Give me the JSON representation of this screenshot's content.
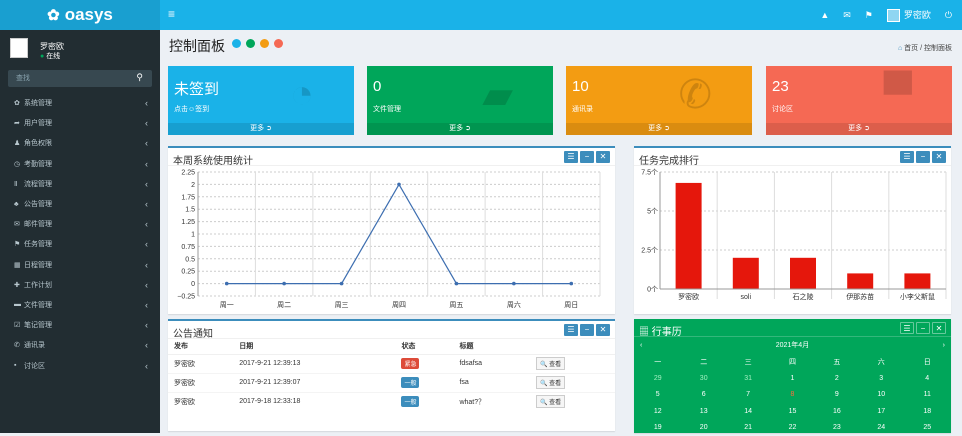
{
  "brand": {
    "logo_text": "oasys",
    "logo_icon": "gear-icon"
  },
  "topbar": {
    "menu_icon": "≡",
    "user_name": "罗密欧",
    "icons": [
      "bell-icon",
      "mail-icon",
      "flag-icon",
      "power-icon"
    ]
  },
  "sidebar": {
    "user_name": "罗密欧",
    "status": "在线",
    "search_placeholder": "查找",
    "items": [
      {
        "label": "系统管理",
        "icon": "✿"
      },
      {
        "label": "用户管理",
        "icon": "➦"
      },
      {
        "label": "角色权限",
        "icon": "♟"
      },
      {
        "label": "考勤管理",
        "icon": "◷"
      },
      {
        "label": "流程管理",
        "icon": "Ⅱ"
      },
      {
        "label": "公告管理",
        "icon": "♣"
      },
      {
        "label": "邮件管理",
        "icon": "✉"
      },
      {
        "label": "任务管理",
        "icon": "⚑"
      },
      {
        "label": "日程管理",
        "icon": "▦"
      },
      {
        "label": "工作计划",
        "icon": "✚"
      },
      {
        "label": "文件管理",
        "icon": "▬"
      },
      {
        "label": "笔记管理",
        "icon": "☑"
      },
      {
        "label": "通讯录",
        "icon": "✆"
      },
      {
        "label": "讨论区",
        "icon": "▪"
      }
    ]
  },
  "header": {
    "title": "控制面板",
    "dot_colors": [
      "#1ab2e8",
      "#00a65a",
      "#f39c12",
      "#f56954"
    ],
    "crumb_home": "首页",
    "crumb_current": "控制面板"
  },
  "stat_boxes": [
    {
      "num": "未签到",
      "label": "点击☺签到",
      "color": "#1ab2e8",
      "icon": "◔",
      "more": "更多 ➲"
    },
    {
      "num": "0",
      "label": "文件管理",
      "color": "#00a65a",
      "icon": "▰",
      "more": "更多 ➲"
    },
    {
      "num": "10",
      "label": "通讯录",
      "color": "#f39c12",
      "icon": "✆",
      "more": "更多 ➲"
    },
    {
      "num": "23",
      "label": "讨论区",
      "color": "#f56954",
      "icon": "▀",
      "more": "更多 ➲"
    }
  ],
  "line_panel": {
    "title": "本周系统使用统计",
    "tools": [
      "☰",
      "−",
      "✕"
    ]
  },
  "bar_panel": {
    "title": "任务完成排行",
    "tools": [
      "☰",
      "−",
      "✕"
    ]
  },
  "notice_panel": {
    "title": "公告通知",
    "tools": [
      "☰",
      "−",
      "✕"
    ],
    "columns": [
      "发布",
      "日期",
      "状态",
      "标题"
    ],
    "rows": [
      {
        "author": "罗密欧",
        "date": "2017-9-21 12:39:13",
        "status": "紧急",
        "status_color": "#dd4b39",
        "title": "fdsafsa",
        "action": "🔍 查看"
      },
      {
        "author": "罗密欧",
        "date": "2017-9-21 12:39:07",
        "status": "一般",
        "status_color": "#3c8dbc",
        "title": "fsa",
        "action": "🔍 查看"
      },
      {
        "author": "罗密欧",
        "date": "2017-9-18 12:33:18",
        "status": "一般",
        "status_color": "#3c8dbc",
        "title": "what?？",
        "action": "🔍 查看"
      }
    ]
  },
  "calendar_panel": {
    "title": "行事历",
    "tools": [
      "☰",
      "−",
      "✕"
    ],
    "month": "2021年4月",
    "prev": "‹",
    "next": "›",
    "weekdays": [
      "一",
      "二",
      "三",
      "四",
      "五",
      "六",
      "日"
    ],
    "weeks": [
      [
        "29",
        "30",
        "31",
        "1",
        "2",
        "3",
        "4"
      ],
      [
        "5",
        "6",
        "7",
        "8",
        "9",
        "10",
        "11"
      ],
      [
        "12",
        "13",
        "14",
        "15",
        "16",
        "17",
        "18"
      ],
      [
        "19",
        "20",
        "21",
        "22",
        "23",
        "24",
        "25"
      ]
    ],
    "today": "8"
  },
  "chart_data": [
    {
      "type": "line",
      "title": "本周系统使用统计",
      "categories": [
        "周一",
        "周二",
        "周三",
        "周四",
        "周五",
        "周六",
        "周日"
      ],
      "series": [
        {
          "values": [
            0,
            0,
            0,
            2,
            0,
            0,
            0
          ]
        }
      ],
      "yticks": [
        "2.25",
        "2",
        "1.75",
        "1.5",
        "1.25",
        "1",
        "0.75",
        "0.5",
        "0.25",
        "0",
        "−0.25"
      ],
      "ylim": [
        -0.25,
        2.25
      ],
      "grid": true,
      "color": "#3d6eb0"
    },
    {
      "type": "bar",
      "title": "任务完成排行",
      "categories": [
        "罗密欧",
        "soli",
        "石之陵",
        "伊那苏苗",
        "小李父斯鼠"
      ],
      "values": [
        6.8,
        2,
        2,
        1,
        1
      ],
      "yticks": [
        "7.5个",
        "5个",
        "2.5个",
        "0个"
      ],
      "ylim": [
        0,
        7.5
      ],
      "color": "#e5170c"
    }
  ]
}
